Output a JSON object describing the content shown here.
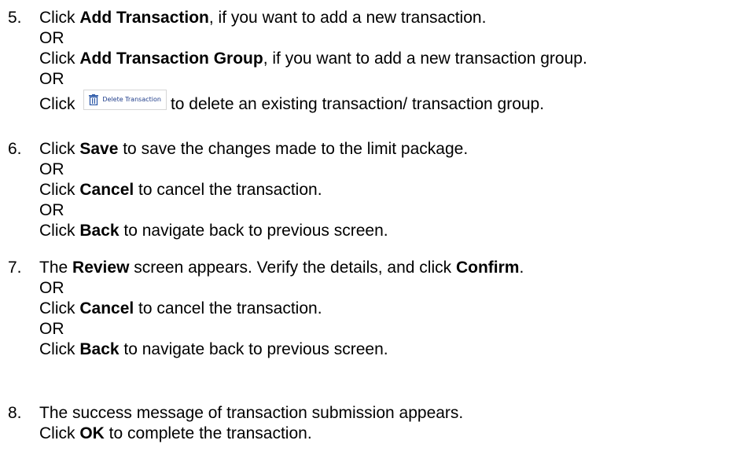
{
  "steps": [
    {
      "number": "5.",
      "lines": [
        {
          "pre": "Click ",
          "bold": "Add Transaction",
          "post": ", if you want to add a new transaction."
        },
        {
          "text": "OR"
        },
        {
          "pre": "Click ",
          "bold": "Add Transaction Group",
          "post": ", if you want to add a new transaction group."
        },
        {
          "text": "OR"
        },
        {
          "pre": "Click ",
          "button_label": "Delete Transaction",
          "post": "to delete an existing transaction/ transaction group."
        }
      ]
    },
    {
      "number": "6.",
      "lines": [
        {
          "pre": "Click ",
          "bold": "Save",
          "post": " to save the changes made to the limit package."
        },
        {
          "text": "OR"
        },
        {
          "pre": "Click ",
          "bold": "Cancel",
          "post": " to cancel the transaction."
        },
        {
          "text": "OR"
        },
        {
          "pre": "Click ",
          "bold": "Back",
          "post": " to navigate back to previous screen."
        }
      ]
    },
    {
      "number": "7.",
      "lines": [
        {
          "pre": "The ",
          "bold": "Review",
          "mid": " screen appears. Verify the details, and click ",
          "bold2": "Confirm",
          "post": "."
        },
        {
          "text": "OR"
        },
        {
          "pre": "Click ",
          "bold": "Cancel",
          "post": " to cancel the transaction."
        },
        {
          "text": "OR"
        },
        {
          "pre": "Click ",
          "bold": "Back",
          "post": " to navigate back to previous screen."
        }
      ]
    },
    {
      "number": "8.",
      "lines": [
        {
          "text": "The success message of transaction submission appears."
        },
        {
          "pre": "Click ",
          "bold": "OK",
          "post": " to complete the transaction."
        }
      ]
    }
  ],
  "icons": {
    "delete_button_icon": "trash-icon"
  },
  "colors": {
    "button_text": "#1f3d8a",
    "icon": "#2e5aa8"
  }
}
